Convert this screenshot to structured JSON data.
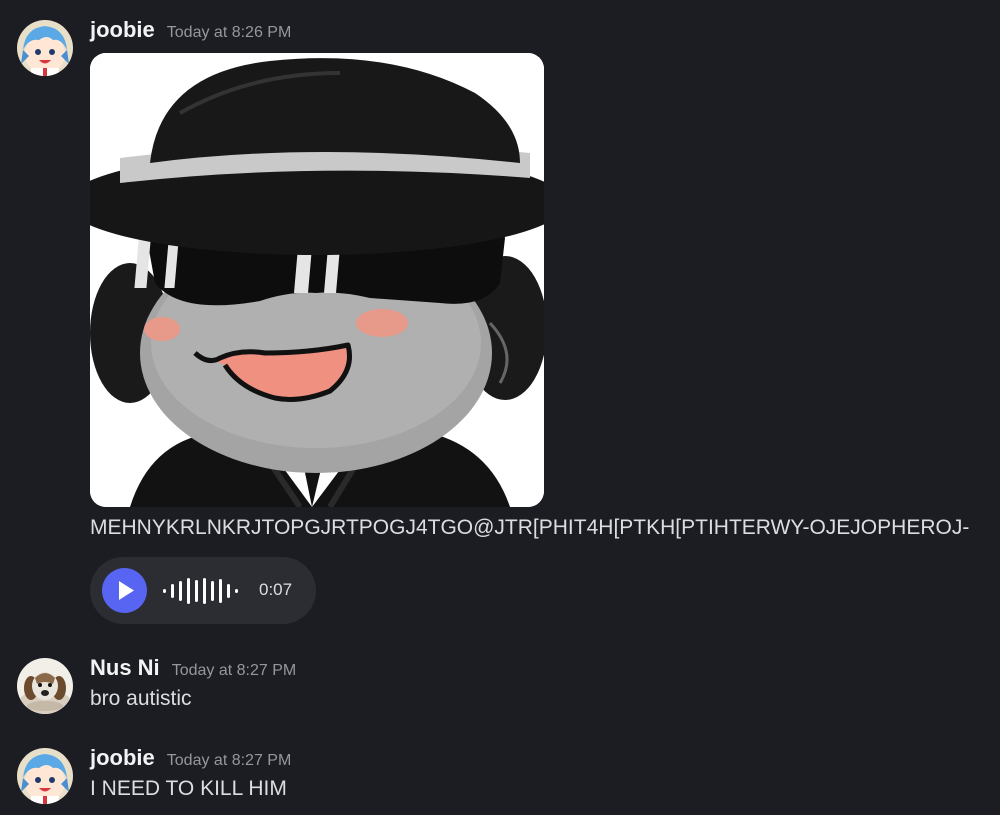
{
  "messages": [
    {
      "username": "joobie",
      "timestamp": "Today at 8:26 PM",
      "text": "MEHNYKRLNKRJTOPGJRTPOGJ4TGO@JTR[PHIT4H[PTKH[PTIHTERWY-OJEJOPHEROJ-",
      "voice": {
        "duration": "0:07"
      }
    },
    {
      "username": "Nus Ni",
      "timestamp": "Today at 8:27 PM",
      "text": "bro autistic"
    },
    {
      "username": "joobie",
      "timestamp": "Today at 8:27 PM",
      "text": "I NEED TO KILL HIM"
    }
  ],
  "colors": {
    "background": "#1c1d22",
    "play_button": "#5865f2",
    "username": "#f2f3f5",
    "timestamp": "#94979e"
  }
}
